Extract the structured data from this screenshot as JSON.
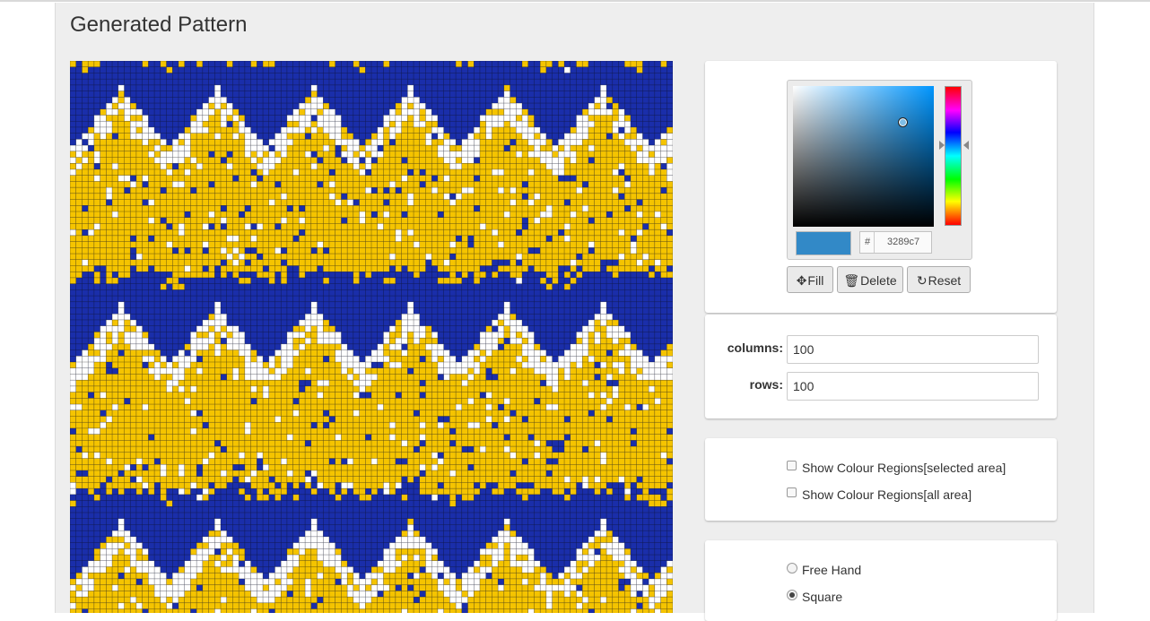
{
  "page": {
    "title": "Generated Pattern"
  },
  "pattern": {
    "columns": 100,
    "rows": 100,
    "colors": {
      "background": "#1a2eaa",
      "primary": "#f5c400",
      "secondary": "#ffffff",
      "gridline": "#0a0a0a"
    }
  },
  "color_picker": {
    "hex_prefix": "#",
    "hex_value": "3289c7",
    "selected_color": "#3289c7"
  },
  "toolbar": {
    "fill": {
      "label": "Fill",
      "icon": "move-icon"
    },
    "delete": {
      "label": "Delete",
      "icon": "trash-icon"
    },
    "reset": {
      "label": "Reset",
      "icon": "refresh-icon"
    }
  },
  "dimensions": {
    "columns_label": "columns:",
    "columns_value": "100",
    "rows_label": "rows:",
    "rows_value": "100"
  },
  "regions": {
    "selected_label": "Show Colour Regions[selected area]",
    "all_label": "Show Colour Regions[all area]"
  },
  "draw_mode": {
    "options": [
      {
        "label": "Free Hand",
        "selected": false
      },
      {
        "label": "Square",
        "selected": true
      }
    ]
  }
}
